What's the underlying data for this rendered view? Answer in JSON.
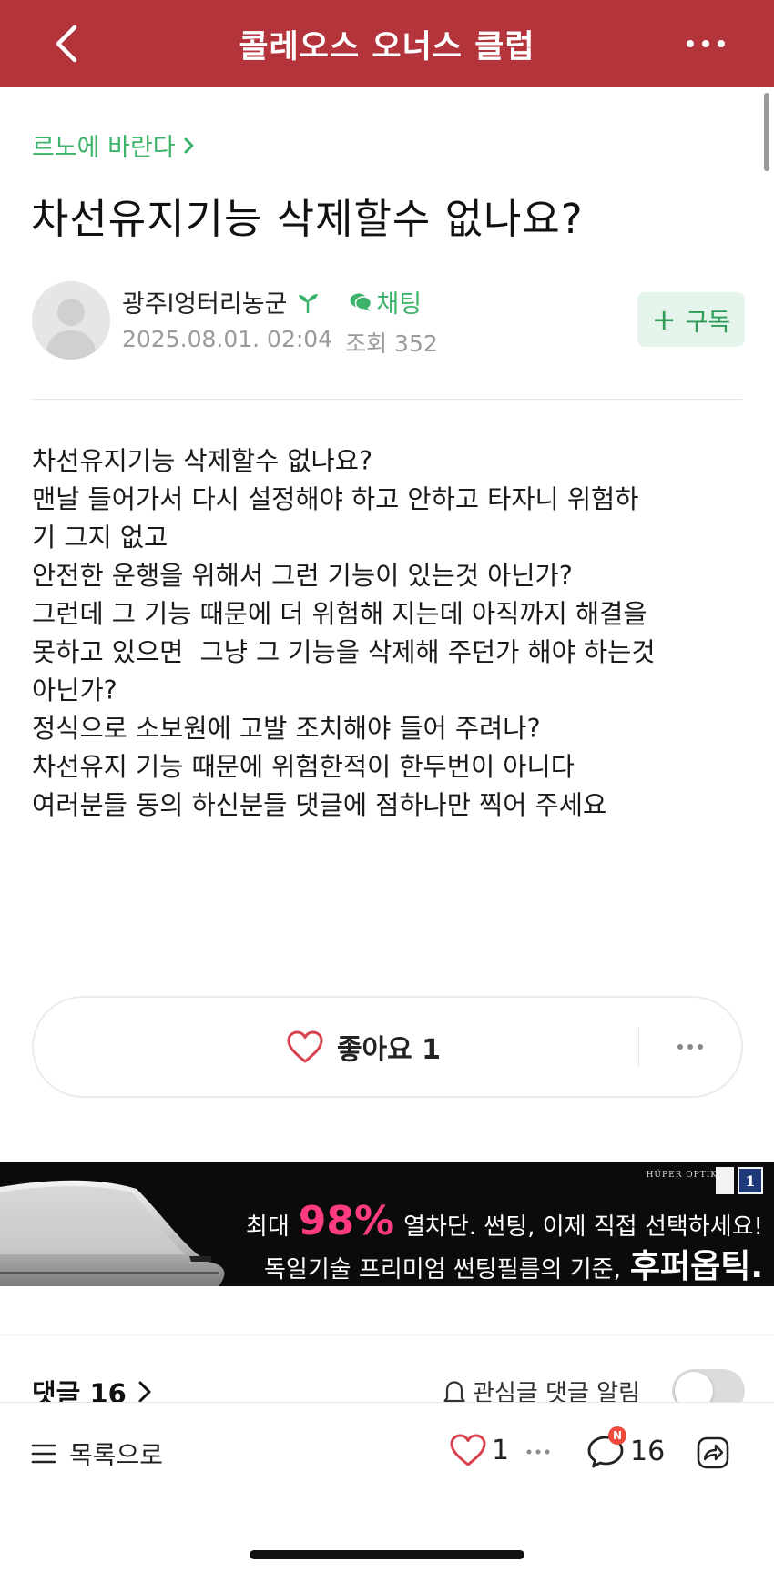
{
  "header": {
    "title": "콜레오스 오너스 클럽",
    "back_icon": "chevron-left-icon",
    "more_icon": "more-horizontal-icon",
    "background_color": "#b3353b"
  },
  "post": {
    "board_name": "르노에 바란다",
    "title": "차선유지기능 삭제할수 없나요?",
    "author": {
      "name": "광주l엉터리농군",
      "chat_label": "채팅",
      "date": "2025.08.01. 02:04",
      "views": "조회 352"
    },
    "subscribe_label": "구독",
    "body_lines": [
      "차선유지기능 삭제할수 없나요?",
      "맨날 들어가서 다시 설정해야 하고 안하고 타자니 위험하",
      "기 그지 없고",
      "안전한 운행을 위해서 그런 기능이 있는것 아닌가?",
      "그런데 그 기능 때문에 더 위험해 지는데 아직까지 해결을",
      "못하고 있으면  그냥 그 기능을 삭제해 주던가 해야 하는것",
      "아닌가?",
      "정식으로 소보원에 고발 조치해야 들어 주려나?",
      "차선유지 기능 때문에 위험한적이 한두번이 아니다",
      "여러분들 동의 하신분들 댓글에 점하나만 찍어 주세요"
    ],
    "like_label": "좋아요 1"
  },
  "ad": {
    "brand": "HÜPER OPTIK",
    "logo_text": "1",
    "line1_prefix": "최대",
    "line1_highlight": "98%",
    "line1_suffix": "열차단. 썬팅, 이제 직접 선택하세요!",
    "line2_prefix": "독일기술 프리미엄 썬팅필름의 기준,",
    "line2_highlight": "후퍼옵틱."
  },
  "comments": {
    "label": "댓글 16",
    "alert_label": "관심글 댓글 알림",
    "alert_enabled": false
  },
  "bottom_bar": {
    "list_label": "목록으로",
    "like_count": "1",
    "comment_count": "16",
    "new_badge": "N"
  },
  "colors": {
    "accent_green": "#3bb36a",
    "heart_red": "#d8434f",
    "badge_red": "#ef4a3c",
    "ad_pink": "#ff3b82"
  }
}
